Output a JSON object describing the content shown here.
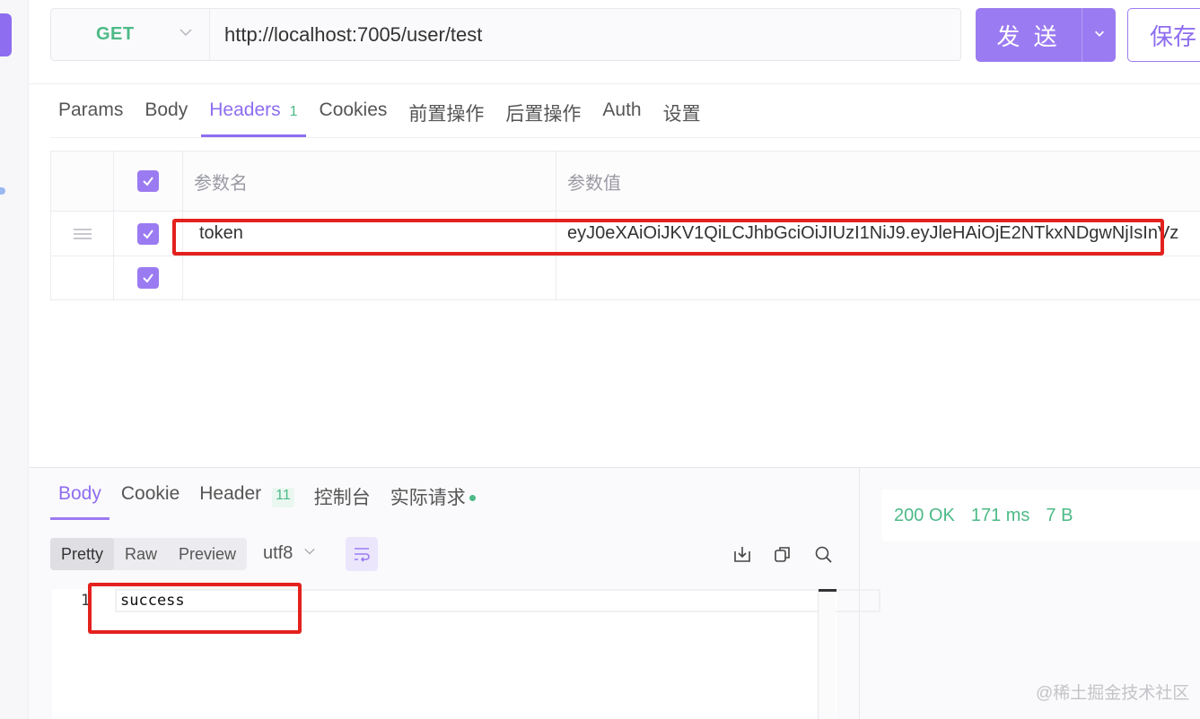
{
  "request": {
    "method": "GET",
    "url": "http://localhost:7005/user/test",
    "send_label": "发 送",
    "save_label": "保存"
  },
  "request_tabs": [
    {
      "label": "Params"
    },
    {
      "label": "Body"
    },
    {
      "label": "Headers",
      "badge": "1"
    },
    {
      "label": "Cookies"
    },
    {
      "label": "前置操作"
    },
    {
      "label": "后置操作"
    },
    {
      "label": "Auth"
    },
    {
      "label": "设置"
    }
  ],
  "headers_table": {
    "col_name": "参数名",
    "col_value": "参数值",
    "rows": [
      {
        "name": "token",
        "value": "eyJ0eXAiOiJKV1QiLCJhbGciOiJIUzI1NiJ9.eyJleHAiOjE2NTkxNDgwNjIsInVz",
        "checked": true
      },
      {
        "name": "",
        "value": "",
        "checked": true
      }
    ]
  },
  "response_tabs": [
    {
      "label": "Body"
    },
    {
      "label": "Cookie"
    },
    {
      "label": "Header",
      "badge": "11"
    },
    {
      "label": "控制台"
    },
    {
      "label": "实际请求"
    }
  ],
  "format": {
    "options": [
      "Pretty",
      "Raw",
      "Preview"
    ],
    "selected": "Pretty",
    "encoding": "utf8"
  },
  "response_body": {
    "line_number": "1",
    "text": "success"
  },
  "status": {
    "code": "200 OK",
    "time": "171 ms",
    "size": "7 B"
  },
  "watermark": "@稀土掘金技术社区",
  "colors": {
    "accent": "#9b7bf1",
    "success": "#4cba86",
    "highlight_box": "#e3211d"
  },
  "icons": [
    "chevron-down-icon",
    "drag-handle-icon",
    "check-icon",
    "wrap-lines-icon",
    "download-icon",
    "copy-icon",
    "search-icon"
  ]
}
